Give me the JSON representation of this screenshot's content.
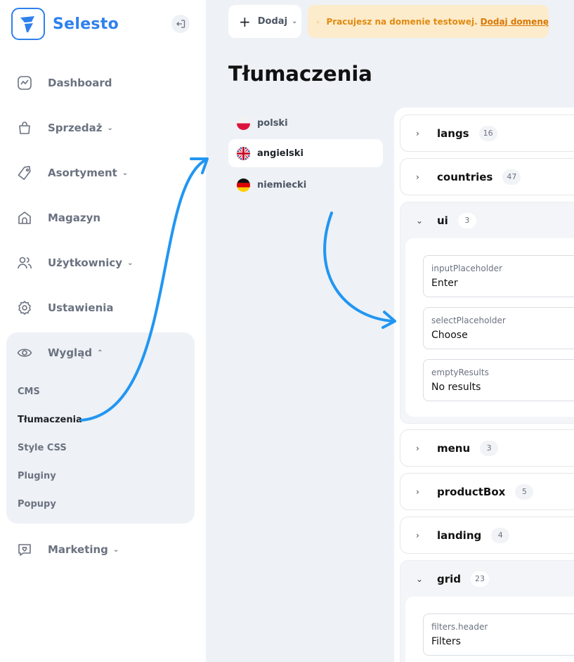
{
  "brand": {
    "name": "Selesto"
  },
  "sidebar": {
    "items": [
      {
        "label": "Dashboard",
        "icon": "chart-line-icon"
      },
      {
        "label": "Sprzedaż",
        "icon": "shopping-bag-icon"
      },
      {
        "label": "Asortyment",
        "icon": "tag-icon"
      },
      {
        "label": "Magazyn",
        "icon": "warehouse-icon"
      },
      {
        "label": "Użytkownicy",
        "icon": "users-icon"
      },
      {
        "label": "Ustawienia",
        "icon": "gear-icon"
      },
      {
        "label": "Wygląd",
        "icon": "eye-icon"
      },
      {
        "label": "Marketing",
        "icon": "heart-chat-icon"
      }
    ],
    "submenu": [
      {
        "label": "CMS"
      },
      {
        "label": "Tłumaczenia"
      },
      {
        "label": "Style CSS"
      },
      {
        "label": "Pluginy"
      },
      {
        "label": "Popupy"
      }
    ]
  },
  "topbar": {
    "add_label": "Dodaj",
    "warning_text": "Pracujesz na domenie testowej.",
    "warning_link": "Dodaj domenę"
  },
  "page": {
    "title": "Tłumaczenia"
  },
  "languages": [
    {
      "label": "polski"
    },
    {
      "label": "angielski"
    },
    {
      "label": "niemiecki"
    }
  ],
  "sections": [
    {
      "name": "langs",
      "count": "16"
    },
    {
      "name": "countries",
      "count": "47"
    },
    {
      "name": "ui",
      "count": "3"
    },
    {
      "name": "menu",
      "count": "3"
    },
    {
      "name": "productBox",
      "count": "5"
    },
    {
      "name": "landing",
      "count": "4"
    },
    {
      "name": "grid",
      "count": "23"
    }
  ],
  "ui_fields": [
    {
      "label": "inputPlaceholder",
      "value": "Enter"
    },
    {
      "label": "selectPlaceholder",
      "value": "Choose"
    },
    {
      "label": "emptyResults",
      "value": "No results"
    }
  ],
  "grid_fields": [
    {
      "label": "filters.header",
      "value": "Filters"
    }
  ],
  "colors": {
    "accent": "#2f80ed",
    "warning_bg": "#fdeccb",
    "warning_text": "#e08a12"
  }
}
